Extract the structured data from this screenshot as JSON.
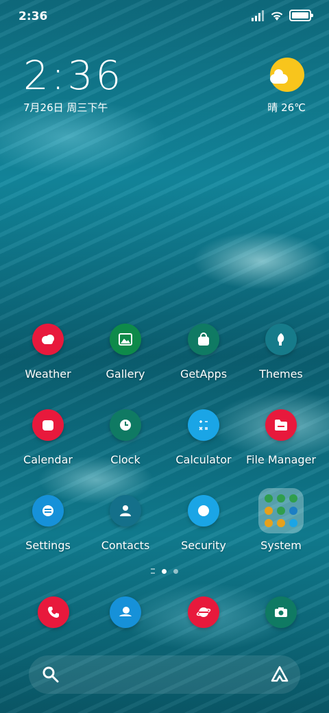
{
  "status_bar": {
    "time": "2:36",
    "signal_icon": "signal-icon",
    "wifi_icon": "wifi-icon",
    "battery_icon": "battery-icon"
  },
  "clock_widget": {
    "time": "2:36",
    "date": "7月26日 周三下午"
  },
  "weather_widget": {
    "icon": "sunny-cloud-icon",
    "text": "晴 26℃",
    "sun_color": "#f8c51c"
  },
  "apps": [
    {
      "label": "Weather",
      "icon": "weather-icon",
      "color": "#e8193c"
    },
    {
      "label": "Gallery",
      "icon": "gallery-icon",
      "color": "#0e8a4a"
    },
    {
      "label": "GetApps",
      "icon": "getapps-icon",
      "color": "#0f7a63"
    },
    {
      "label": "Themes",
      "icon": "themes-icon",
      "color": "#167b8a"
    },
    {
      "label": "Calendar",
      "icon": "calendar-icon",
      "color": "#e8193c"
    },
    {
      "label": "Clock",
      "icon": "clock-icon",
      "color": "#0f7a63"
    },
    {
      "label": "Calculator",
      "icon": "calculator-icon",
      "color": "#1aa5e6"
    },
    {
      "label": "File Manager",
      "icon": "file-manager-icon",
      "color": "#e8193c"
    },
    {
      "label": "Settings",
      "icon": "settings-icon",
      "color": "#1691d9"
    },
    {
      "label": "Contacts",
      "icon": "contacts-icon",
      "color": "#14708a"
    },
    {
      "label": "Security",
      "icon": "security-icon",
      "color": "#1aa5e6"
    },
    {
      "label": "System",
      "icon": "system-folder-icon",
      "color": "#c9e6e6"
    }
  ],
  "dock": [
    {
      "name": "phone",
      "icon": "phone-icon",
      "color": "#e8193c"
    },
    {
      "name": "messages",
      "icon": "messages-icon",
      "color": "#1691d9"
    },
    {
      "name": "browser",
      "icon": "browser-icon",
      "color": "#e8193c"
    },
    {
      "name": "camera",
      "icon": "camera-icon",
      "color": "#0f7a63"
    }
  ],
  "page_indicator": {
    "pages": 2,
    "active": 1
  },
  "search_bar": {
    "left_icon": "search-icon",
    "right_icon": "assistant-icon"
  }
}
